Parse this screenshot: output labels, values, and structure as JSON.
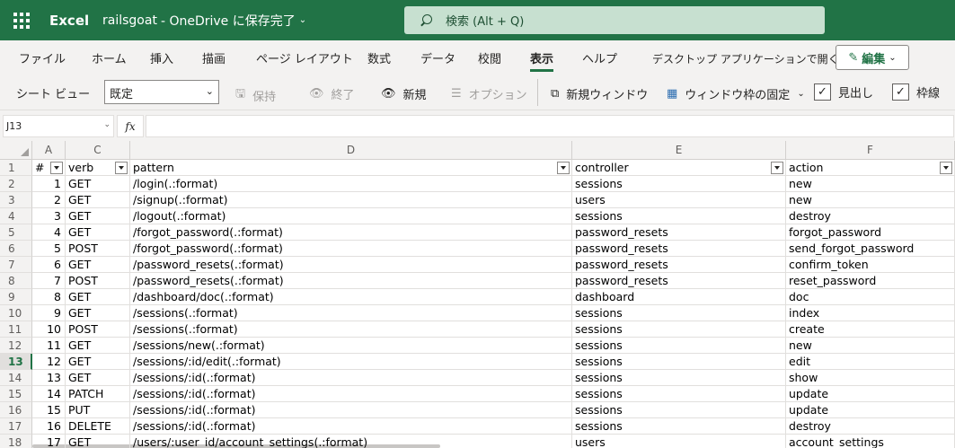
{
  "titlebar": {
    "app_name": "Excel",
    "doc_name": "railsgoat",
    "save_status": "-  OneDrive に保存完了",
    "search_placeholder": "検索 (Alt + Q)"
  },
  "menu": {
    "tabs": [
      "ファイル",
      "ホーム",
      "挿入",
      "描画",
      "ページ レイアウト",
      "数式",
      "データ",
      "校閲",
      "表示",
      "ヘルプ"
    ],
    "active_tab": "表示",
    "open_desktop": "デスクトップ アプリケーションで開く",
    "edit_button": "編集"
  },
  "ribbon": {
    "sheet_view_label": "シート ビュー",
    "sheet_view_value": "既定",
    "keep": "保持",
    "exit": "終了",
    "new": "新規",
    "options": "オプション",
    "new_window": "新規ウィンドウ",
    "freeze_panes": "ウィンドウ枠の固定",
    "headings": "見出し",
    "gridlines": "枠線",
    "headings_checked": true,
    "gridlines_checked": true
  },
  "formula": {
    "name_box": "J13",
    "fx": "fx",
    "value": ""
  },
  "grid": {
    "columns": [
      "A",
      "C",
      "D",
      "E",
      "F"
    ],
    "headers": [
      "#",
      "verb",
      "pattern",
      "controller",
      "action"
    ],
    "selected_row": 13,
    "rows": [
      [
        "1",
        "GET",
        "/login(.:format)",
        "sessions",
        "new"
      ],
      [
        "2",
        "GET",
        "/signup(.:format)",
        "users",
        "new"
      ],
      [
        "3",
        "GET",
        "/logout(.:format)",
        "sessions",
        "destroy"
      ],
      [
        "4",
        "GET",
        "/forgot_password(.:format)",
        "password_resets",
        "forgot_password"
      ],
      [
        "5",
        "POST",
        "/forgot_password(.:format)",
        "password_resets",
        "send_forgot_password"
      ],
      [
        "6",
        "GET",
        "/password_resets(.:format)",
        "password_resets",
        "confirm_token"
      ],
      [
        "7",
        "POST",
        "/password_resets(.:format)",
        "password_resets",
        "reset_password"
      ],
      [
        "8",
        "GET",
        "/dashboard/doc(.:format)",
        "dashboard",
        "doc"
      ],
      [
        "9",
        "GET",
        "/sessions(.:format)",
        "sessions",
        "index"
      ],
      [
        "10",
        "POST",
        "/sessions(.:format)",
        "sessions",
        "create"
      ],
      [
        "11",
        "GET",
        "/sessions/new(.:format)",
        "sessions",
        "new"
      ],
      [
        "12",
        "GET",
        "/sessions/:id/edit(.:format)",
        "sessions",
        "edit"
      ],
      [
        "13",
        "GET",
        "/sessions/:id(.:format)",
        "sessions",
        "show"
      ],
      [
        "14",
        "PATCH",
        "/sessions/:id(.:format)",
        "sessions",
        "update"
      ],
      [
        "15",
        "PUT",
        "/sessions/:id(.:format)",
        "sessions",
        "update"
      ],
      [
        "16",
        "DELETE",
        "/sessions/:id(.:format)",
        "sessions",
        "destroy"
      ],
      [
        "17",
        "GET",
        "/users/:user_id/account_settings(.:format)",
        "users",
        "account_settings"
      ]
    ]
  },
  "colors": {
    "brand": "#217346",
    "ribbon_bg": "#f3f2f1"
  }
}
